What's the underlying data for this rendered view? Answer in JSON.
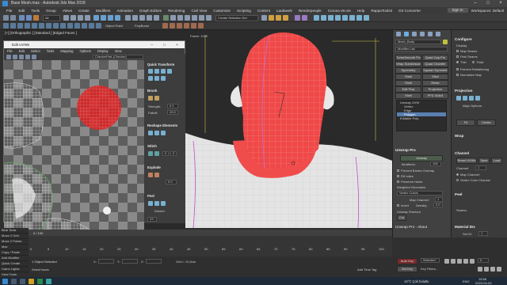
{
  "window": {
    "title": "Base Mesh.max - Autodesk 3ds Max 2018"
  },
  "menu": {
    "items": [
      "File",
      "Edit",
      "Tools",
      "Group",
      "Views",
      "Create",
      "Modifiers",
      "Animation",
      "Graph Editors",
      "Rendering",
      "Civil View",
      "Customize",
      "Scripting",
      "Content",
      "Laubwerk",
      "Renderpeople",
      "Corona v8.ore",
      "Help",
      "RappaTools3",
      "DS Converter"
    ],
    "sign_in": "Sign In",
    "workspaces": "Workspaces: Default"
  },
  "toolbar": {
    "view_dropdown": "All",
    "create_selection_set": "Create Selection Set",
    "object_paint": "Object Paint",
    "polyboost": "PolyBoost",
    "ribbon_items": [
      "Modeling",
      "Freeform",
      "Selection",
      "Object Paint",
      "Populate"
    ],
    "modeling_dropdown": "Polygon Modeling"
  },
  "viewport": {
    "label": "[+] [Orthographic ] [Standard ] [Edged Faces ]",
    "faces_label": "Faces: 1138"
  },
  "uv_editor": {
    "title": "Edit UVWs",
    "menu": [
      "File",
      "Edit",
      "Select",
      "Tools",
      "Mapping",
      "Options",
      "Display",
      "View"
    ],
    "map_dropdown": "CheckerPatt..(Checker)",
    "sections": {
      "quick_transform": "Quick Transform",
      "brush": "Brush",
      "reshape_elements": "Reshape Elements",
      "stitch": "Stitch",
      "explode": "Explode",
      "peel": "Peel",
      "arrange": "Arrange Elements"
    },
    "brush_labels": [
      "Strength:",
      "Falloff:"
    ],
    "brush_values": [
      "0.1",
      "20.0"
    ],
    "stitch_values": [
      "0",
      "0"
    ],
    "explode_value": "0.0",
    "peel_value": "Detach",
    "zoom_value": "XY",
    "status": "100",
    "bottom_values": [
      "0.0",
      "0.0"
    ]
  },
  "command_panel": {
    "object_name": "Mesh_Body",
    "modifier_list": "Modifier List",
    "buttons": [
      [
        "TurboSmooth Pro",
        "Quad Cap Pro"
      ],
      [
        "Wrap Subdivision",
        "Quad Chamfer"
      ],
      [
        "Symmetry",
        "Squash Symmetry"
      ],
      [
        "Shell",
        "Slice"
      ],
      [
        "Shell",
        "Relax"
      ],
      [
        "Edit Poly",
        "Projection"
      ],
      [
        "Shell",
        "FFD 3x3x3"
      ]
    ],
    "stack": [
      "Unwrap UVW",
      "Vertex",
      "Edge",
      "Polygon",
      "Editable Poly"
    ],
    "stack_selected": 3,
    "unwrap_map_header": "Unwrap Pro",
    "unwrap_button": "Unwrap",
    "iterations_label": "Iterations:",
    "iterations_value": "100",
    "prevent_border_overlap": "Prevent Border Overlap",
    "fill_holes": "Fill holes",
    "preserve_holes": "Preserve Holes",
    "weighted_geometric": "Weighted Geometric",
    "vertex_colors_dropdown": "Vertex Colors",
    "map_channel_label": "Map Channel:",
    "map_channel_value": "1",
    "invert_label": "Invert",
    "density_label": "Density:",
    "density_value": "0.0",
    "unwrap_shortcuts": "Unwrap Shortcut",
    "cut_label": "Cut",
    "unwrap_about": "Unwrap Pro - About"
  },
  "right_panel": {
    "configure": "Configure",
    "display_label": "Display:",
    "map_seams": "Map Seams",
    "peel_seams": "Peel Seams",
    "thin": "Thin",
    "thick": "Thick",
    "prevent_reflattening": "Prevent Reflattening",
    "normalize_map": "Normalize Map",
    "projection": "Projection",
    "align_options": "Align Options:",
    "fit": "Fit",
    "center": "Center",
    "wrap": "Wrap",
    "channel": "Channel",
    "reset_uvws": "Reset UVWs",
    "save": "Save",
    "load": "Load",
    "channel_label": "Channel:",
    "channel_value": "1",
    "map_channel": "Map Channel:",
    "vertex_color_channel": "Vertex Color Channel",
    "peel": "Peel",
    "seams": "Seams:",
    "material_ids": "Material IDs",
    "set_id_label": "Set ID:",
    "set_id_value": "1",
    "select_id": "Select ID"
  },
  "left_tools": [
    "Blub Tools",
    "Move 2 Grid",
    "Move 2 Points",
    "Max",
    "Copy / Paste",
    "Add Modifier",
    "Quick Create",
    "Camo Lights",
    "View Tools"
  ],
  "timeline": {
    "ticks": [
      "0",
      "5",
      "10",
      "15",
      "20",
      "25",
      "30",
      "35",
      "40",
      "45",
      "50",
      "55",
      "60",
      "65",
      "70",
      "75",
      "80",
      "85",
      "90",
      "95",
      "100"
    ],
    "frame_display": "0 / 100"
  },
  "status": {
    "selection": "1 Object Selected",
    "prompt": "Select faces",
    "x_label": "X:",
    "x_value": "",
    "y_label": "Y:",
    "y_value": "",
    "z_label": "Z:",
    "z_value": "",
    "grid": "Grid = 10,0cm",
    "add_time_tag": "Add Time Tag",
    "auto_key": "Auto Key",
    "set_key": "Set Key",
    "selected": "Selected",
    "key_filters": "Key Filters...",
    "frame_value": "0"
  },
  "taskbar": {
    "weather": "14°C  Çok bulutlu",
    "time": "15:58",
    "date": "2023-04-03",
    "lang": "ENG"
  }
}
